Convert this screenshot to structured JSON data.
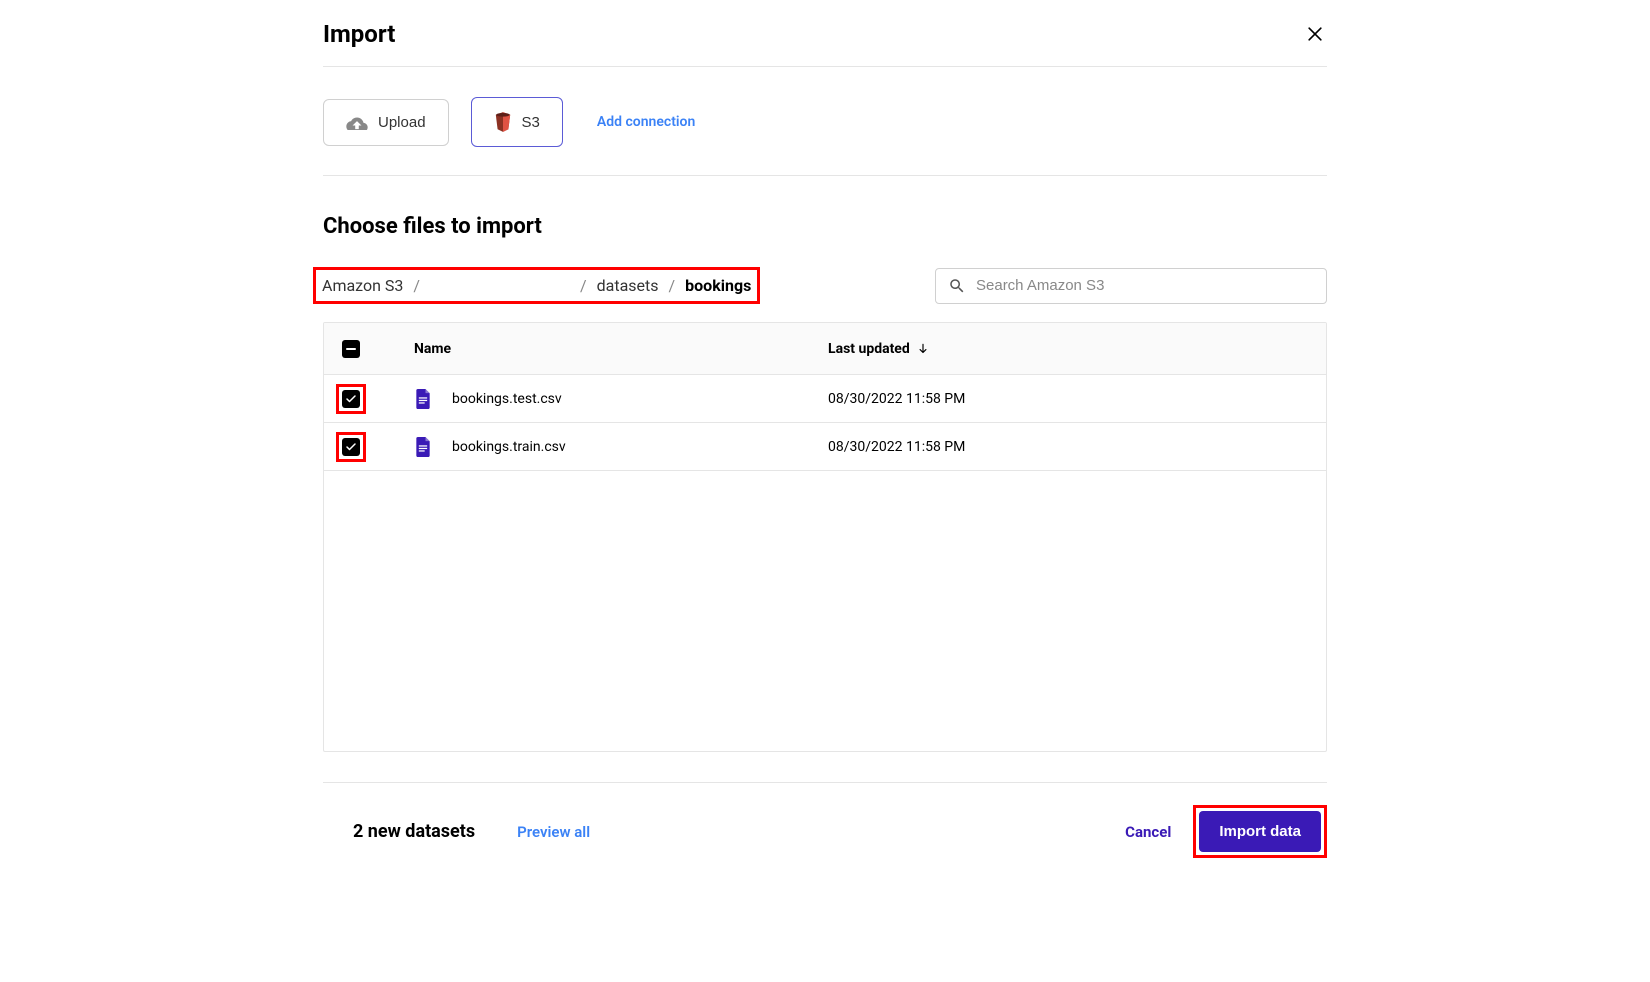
{
  "header": {
    "title": "Import"
  },
  "sources": {
    "upload_label": "Upload",
    "s3_label": "S3",
    "add_connection_label": "Add connection"
  },
  "section": {
    "choose_files_title": "Choose files to import"
  },
  "breadcrumb": {
    "root": "Amazon S3",
    "datasets": "datasets",
    "current": "bookings"
  },
  "search": {
    "placeholder": "Search Amazon S3"
  },
  "table": {
    "headers": {
      "name": "Name",
      "last_updated": "Last updated"
    },
    "rows": [
      {
        "name": "bookings.test.csv",
        "last_updated": "08/30/2022 11:58 PM"
      },
      {
        "name": "bookings.train.csv",
        "last_updated": "08/30/2022 11:58 PM"
      }
    ]
  },
  "footer": {
    "dataset_count": "2 new datasets",
    "preview_all": "Preview all",
    "cancel": "Cancel",
    "import": "Import data"
  }
}
